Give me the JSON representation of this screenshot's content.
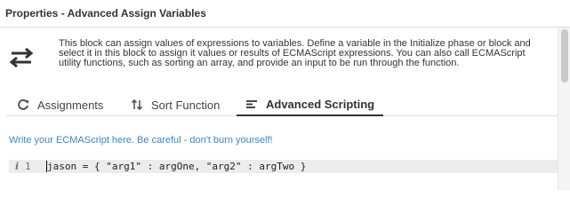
{
  "header": {
    "title": "Properties - Advanced Assign Variables"
  },
  "block": {
    "icon": "swap-arrows-icon",
    "description": "This block can assign values of expressions to variables. Define a variable in the Initialize phase or block and select it in this block to assign it values or results of ECMAScript expressions. You can also call ECMAScript utility functions, such as sorting an array, and provide an input to be run through the function."
  },
  "tabs": [
    {
      "label": "Assignments",
      "icon": "refresh-icon",
      "active": false
    },
    {
      "label": "Sort Function",
      "icon": "sort-icon",
      "active": false
    },
    {
      "label": "Advanced Scripting",
      "icon": "script-lines-icon",
      "active": true
    }
  ],
  "editor": {
    "hint": "Write your ECMAScript here. Be careful - don't burn yourself!",
    "gutter_info_glyph": "i",
    "lines": [
      {
        "number": "1",
        "text": "jason = { \"arg1\" : argOne, \"arg2\" : argTwo }"
      }
    ]
  },
  "colors": {
    "hint_text": "#3a87c8",
    "code_line_bg": "#ececec",
    "header_border": "#dcdcdc"
  }
}
